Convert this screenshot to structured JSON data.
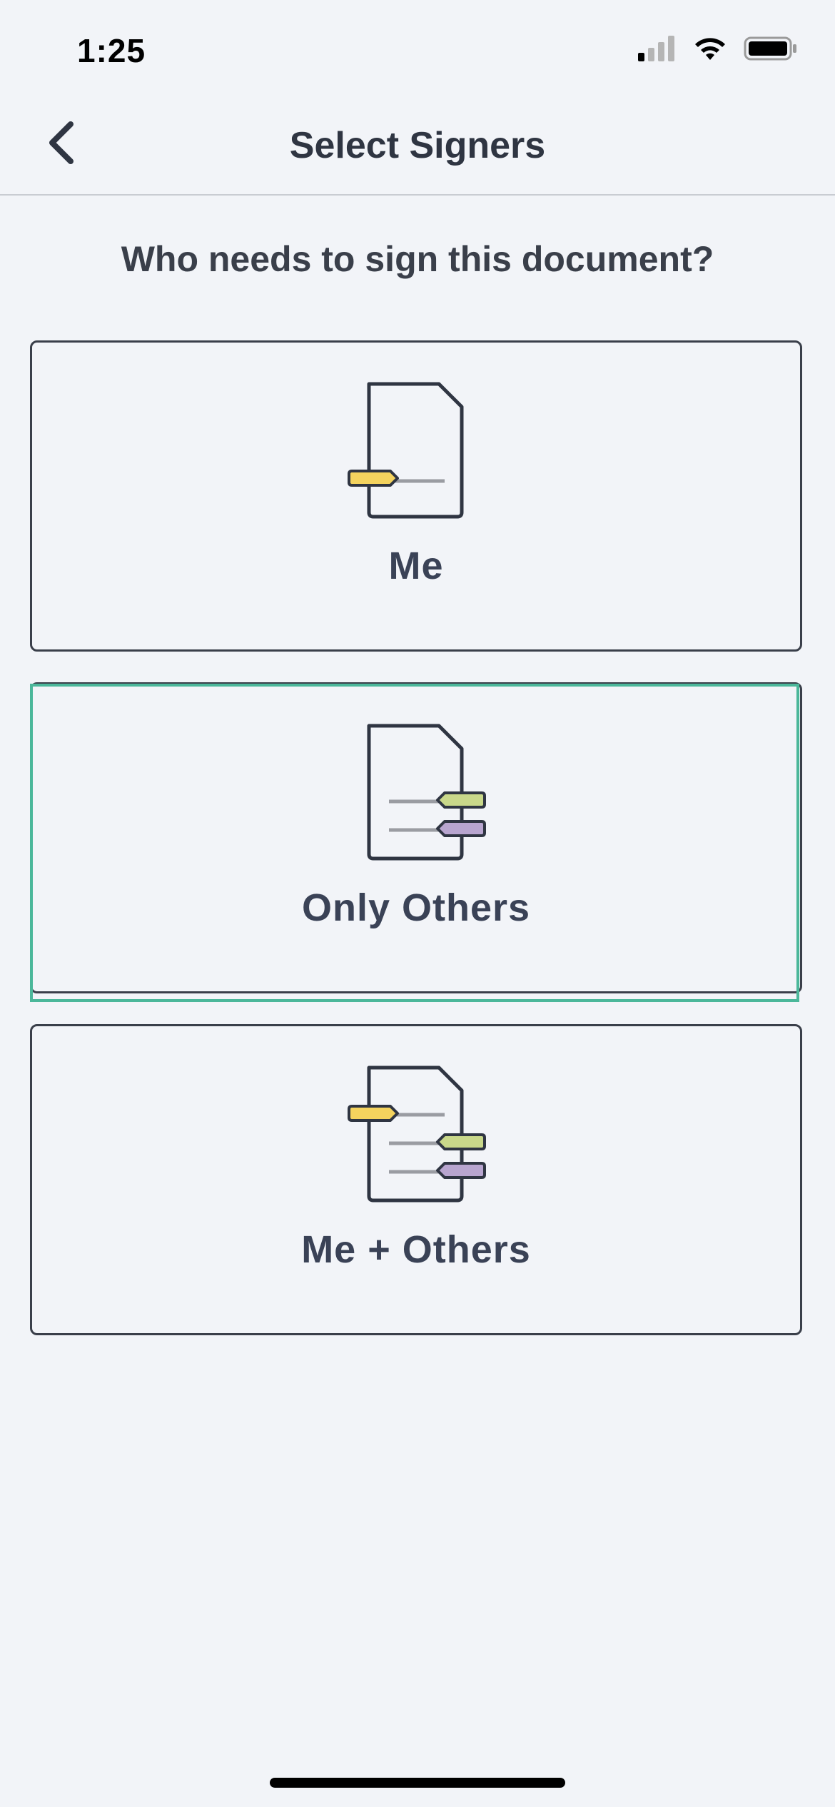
{
  "status_bar": {
    "time": "1:25",
    "icons": [
      "cellular-signal-icon",
      "wifi-icon",
      "battery-icon"
    ]
  },
  "header": {
    "back_icon": "chevron-left-icon",
    "title": "Select Signers"
  },
  "question": "Who needs to sign this document?",
  "options": [
    {
      "label": "Me",
      "icon": "document-me-icon"
    },
    {
      "label": "Only Others",
      "icon": "document-others-icon",
      "focused": true
    },
    {
      "label": "Me + Others",
      "icon": "document-me-others-icon"
    }
  ],
  "colors": {
    "background": "#f2f4f8",
    "text": "#2f3542",
    "focus_ring": "#4bb79a",
    "tag_me": "#f4d35e",
    "tag_other_1": "#c9d88a",
    "tag_other_2": "#b8a5cf"
  }
}
